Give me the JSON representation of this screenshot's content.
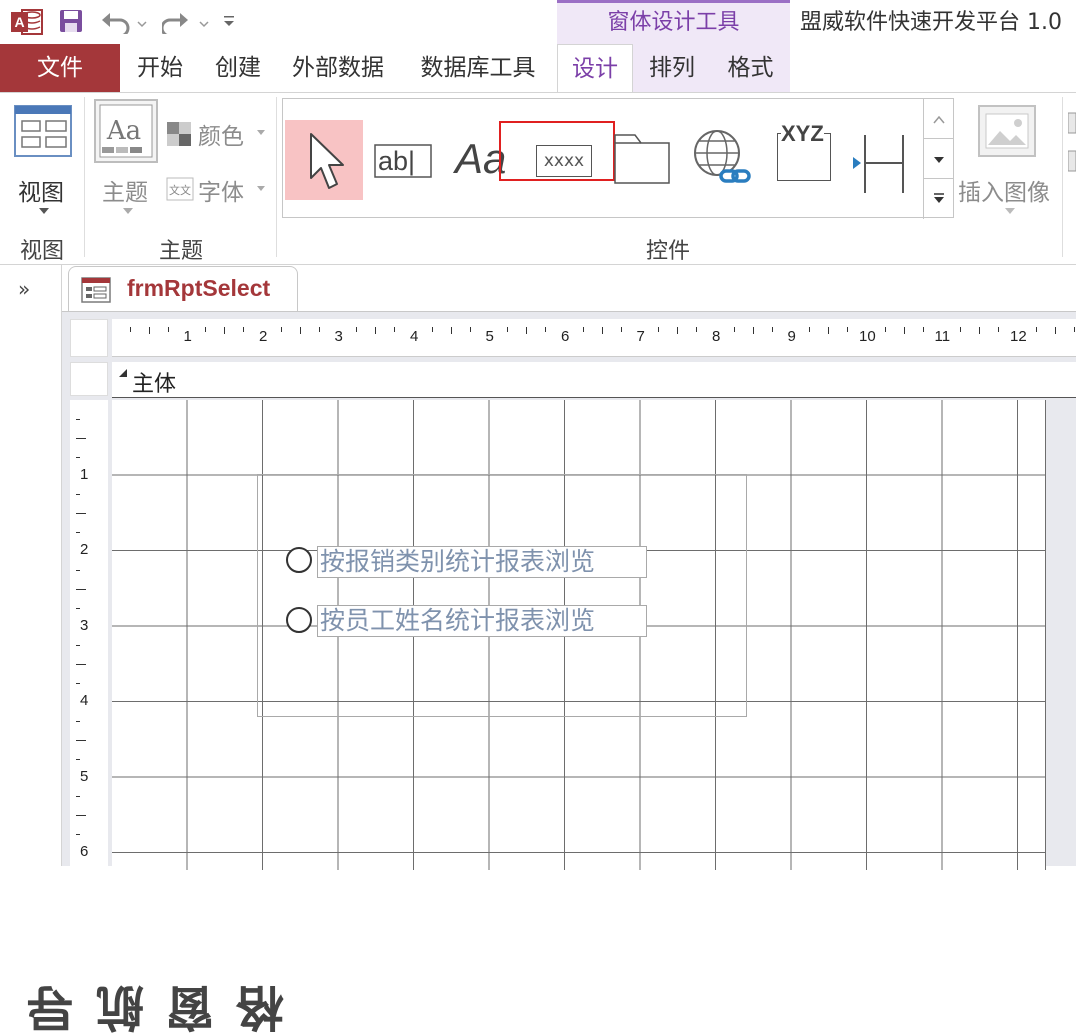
{
  "title_bar": {
    "contextual_header": "窗体设计工具",
    "app_title": "盟威软件快速开发平台 1.0"
  },
  "tabs": {
    "file": "文件",
    "items": [
      "开始",
      "创建",
      "外部数据",
      "数据库工具",
      "设计",
      "排列",
      "格式"
    ],
    "active": "设计"
  },
  "ribbon": {
    "views": {
      "button": "视图",
      "group": "视图"
    },
    "themes": {
      "button": "主题",
      "colors": "颜色",
      "fonts": "字体",
      "group": "主题"
    },
    "controls": {
      "group": "控件",
      "textbox_sample": "ab|",
      "label_sample": "Aa",
      "combo_sample": "xxxx",
      "unbound_sample": "XYZ",
      "selected_control": "xxxx"
    },
    "insert_image": "插入图像"
  },
  "document": {
    "tab_title": "frmRptSelect",
    "nav_collapse": "»",
    "nav_pane_title": "导航窗格",
    "section": "主体",
    "ruler_numbers": [
      "1",
      "2",
      "3",
      "4",
      "5",
      "6",
      "7",
      "8",
      "9",
      "10",
      "11",
      "12"
    ],
    "vruler_numbers": [
      "1",
      "2",
      "3",
      "4",
      "5",
      "6"
    ],
    "options": [
      {
        "label": "按报销类别统计报表浏览"
      },
      {
        "label": "按员工姓名统计报表浏览"
      }
    ]
  },
  "colors": {
    "file_tab": "#a4373a",
    "contextual": "#7b3fa8",
    "highlight_box": "#e02020"
  }
}
